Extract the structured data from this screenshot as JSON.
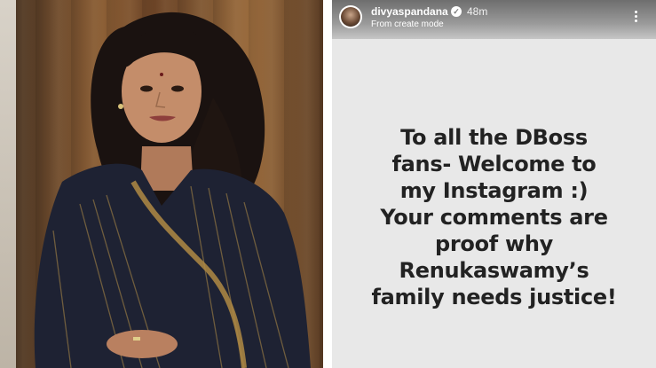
{
  "story": {
    "username": "divyaspandana",
    "verified_glyph": "✓",
    "time": "48m",
    "subtitle": "From create mode",
    "lines": [
      "To all the DBoss",
      "fans- Welcome to",
      "my Instagram :)",
      "Your comments  are",
      "proof why",
      "Renukaswamy’s",
      "family needs justice!"
    ]
  },
  "icons": {
    "verified": "verified-badge-icon",
    "more": "more-vertical-icon",
    "avatar": "profile-avatar"
  },
  "colors": {
    "story_background": "#e8e8e8",
    "story_text": "#222222",
    "photo_sari": "#1e2233",
    "photo_background": "#8a5d34"
  }
}
